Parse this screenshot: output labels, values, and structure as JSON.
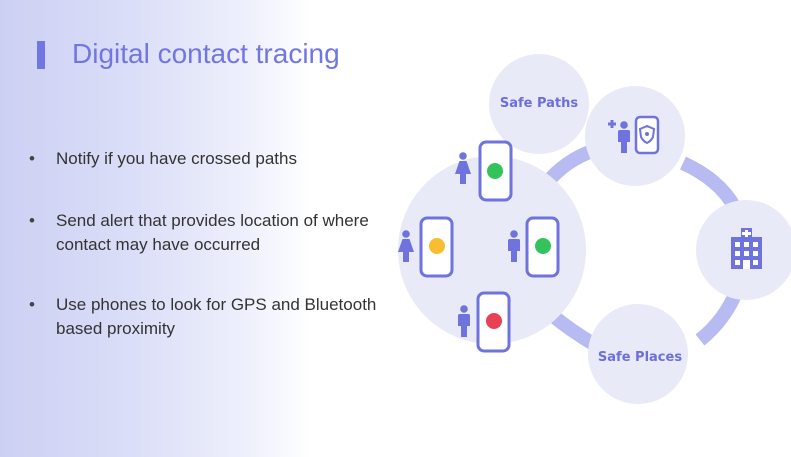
{
  "slide": {
    "title": "Digital contact tracing",
    "bullets": [
      "Notify if you have crossed paths",
      "Send alert that provides location of where contact may have occurred",
      "Use phones to look for GPS and Bluetooth based proximity"
    ]
  },
  "diagram": {
    "safe_paths_label": "Safe Paths",
    "safe_places_label": "Safe Places",
    "status_colors": {
      "green": "#33c35a",
      "yellow": "#f9bd32",
      "red": "#e84055"
    },
    "icons": [
      "person-icon",
      "phone-icon",
      "shield-icon",
      "hospital-icon"
    ]
  },
  "colors": {
    "accent": "#7176e3",
    "circle_fill": "#e9eaf8",
    "arrow": "#b7bbf1"
  }
}
